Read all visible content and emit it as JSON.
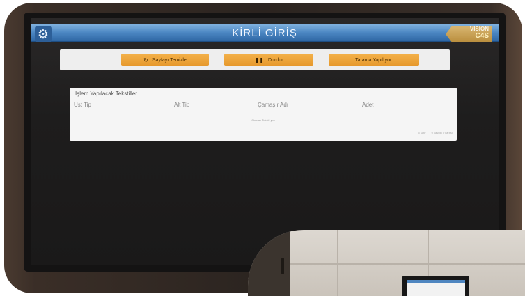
{
  "header": {
    "title": "KİRLİ GİRİŞ",
    "logo_line1": "VISION",
    "logo_line2": "C4S"
  },
  "actions": {
    "clear_label": "Sayfayı Temizle",
    "clear_icon": "refresh-icon",
    "stop_label": "Durdur",
    "stop_icon": "pause-icon",
    "scan_label": "Tarama Yapılıyor."
  },
  "table": {
    "title": "İşlem Yapılacak Tekstiller",
    "columns": [
      "Üst Tip",
      "Alt Tip",
      "Çamaşır Adı",
      "Adet"
    ],
    "empty_text": "Okunan Tekstil yok",
    "rows_per_page": "5 satır",
    "range_text": "0 kaydın 0'ı arası"
  },
  "colors": {
    "header_blue": "#4b86c2",
    "button_orange": "#e6982c",
    "logo_gold": "#c9a055"
  }
}
